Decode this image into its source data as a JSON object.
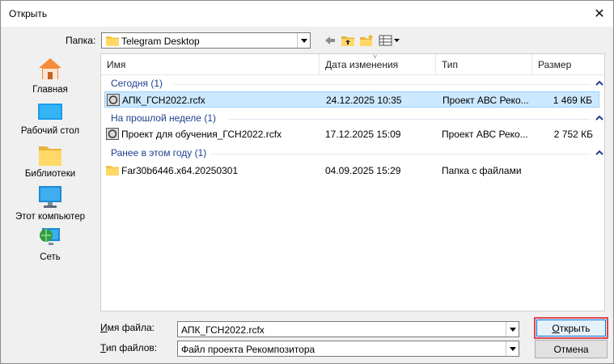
{
  "window": {
    "title": "Открыть"
  },
  "lookin": {
    "label": "Папка:",
    "value": "Telegram Desktop"
  },
  "places": [
    {
      "label": "Главная",
      "icon": "home-icon"
    },
    {
      "label": "Рабочий стол",
      "icon": "desktop-icon"
    },
    {
      "label": "Библиотеки",
      "icon": "libraries-icon"
    },
    {
      "label": "Этот компьютер",
      "icon": "computer-icon"
    },
    {
      "label": "Сеть",
      "icon": "network-icon"
    }
  ],
  "columns": [
    "Имя",
    "Дата изменения",
    "Тип",
    "Размер"
  ],
  "groups": [
    {
      "title": "Сегодня (1)",
      "rows": [
        {
          "name": "АПК_ГСН2022.rcfx",
          "date": "24.12.2025 10:35",
          "type": "Проект АВС Реко...",
          "size": "1 469 КБ",
          "selected": true,
          "icon": "rcfx-file-icon"
        }
      ]
    },
    {
      "title": "На прошлой неделе (1)",
      "rows": [
        {
          "name": "Проект для обучения_ГСН2022.rcfx",
          "date": "17.12.2025 15:09",
          "type": "Проект АВС Реко...",
          "size": "2 752 КБ",
          "selected": false,
          "icon": "rcfx-file-icon"
        }
      ]
    },
    {
      "title": "Ранее в этом году (1)",
      "rows": [
        {
          "name": "Far30b6446.x64.20250301",
          "date": "04.09.2025 15:29",
          "type": "Папка с файлами",
          "size": "",
          "selected": false,
          "icon": "folder-icon"
        }
      ]
    }
  ],
  "filename": {
    "label_prefix": "",
    "label_u": "И",
    "label_rest": "мя файла:",
    "value": "АПК_ГСН2022.rcfx"
  },
  "filetype": {
    "label_u": "Т",
    "label_rest": "ип файлов:",
    "value": "Файл проекта Рекомпозитора"
  },
  "buttons": {
    "open_u": "О",
    "open_rest": "ткрыть",
    "cancel": "Отмена"
  }
}
